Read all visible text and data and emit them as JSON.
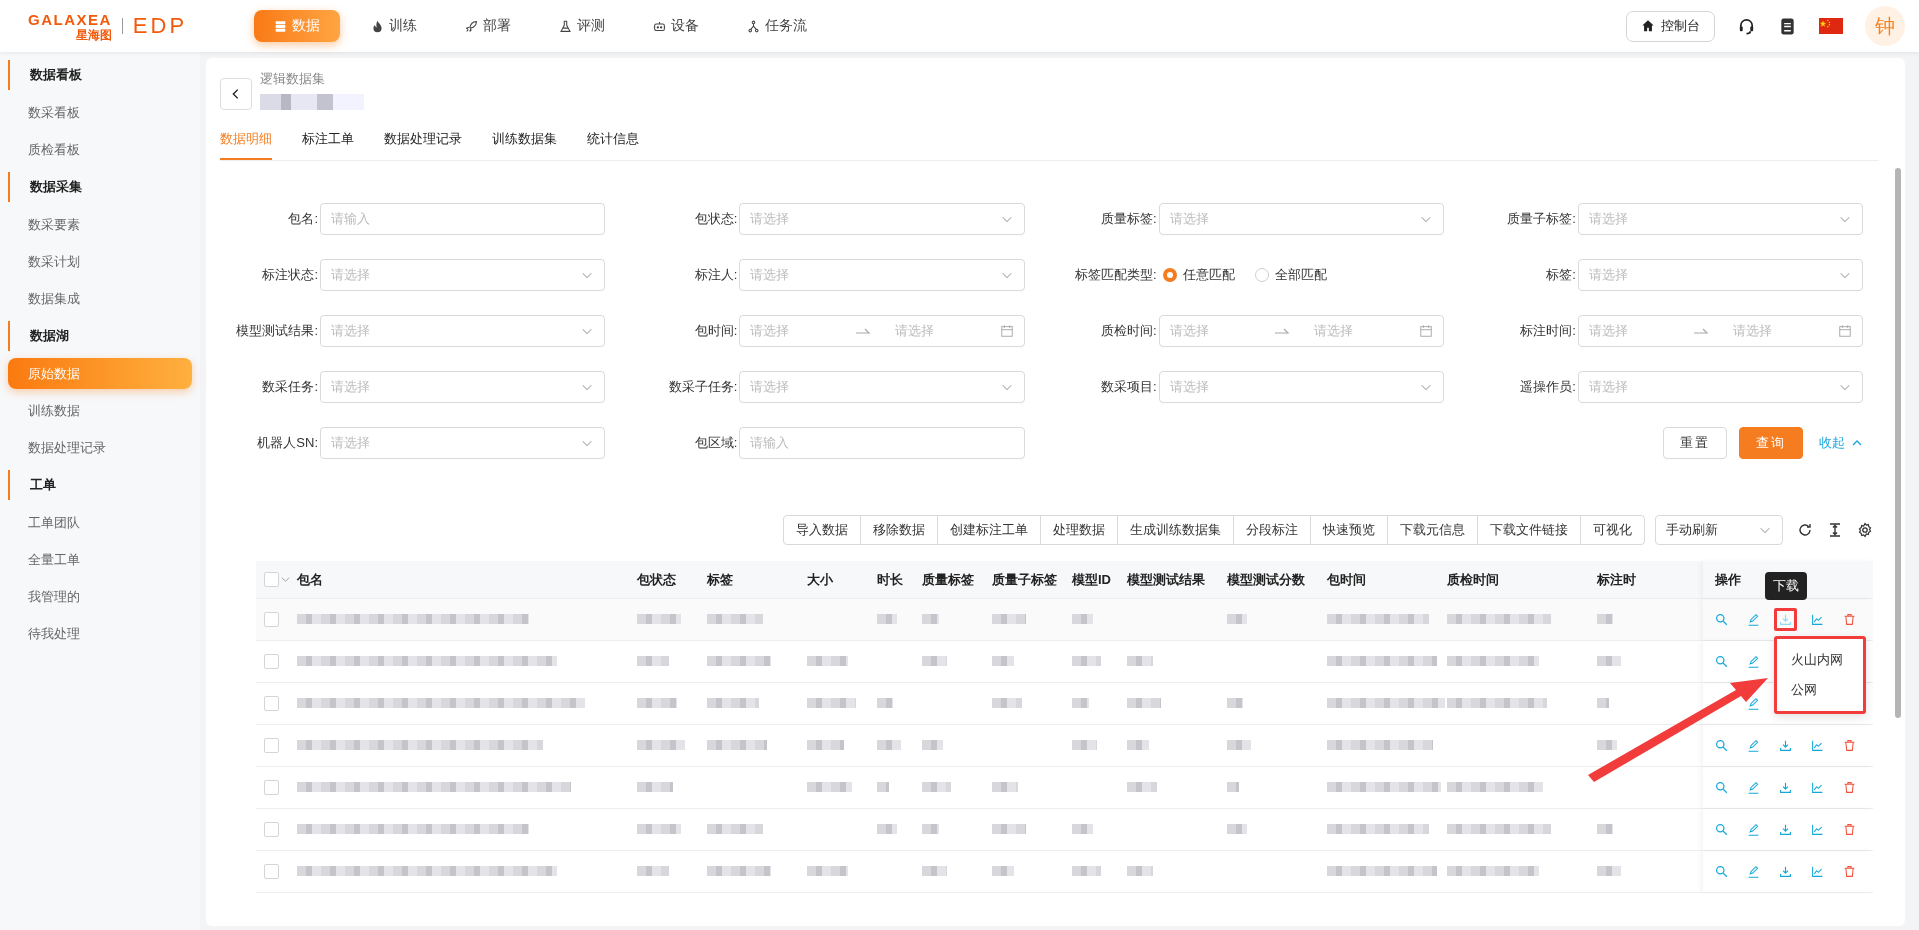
{
  "logo": {
    "wordmark": "GALAXEA",
    "name": "星海图",
    "product": "EDP"
  },
  "nav": [
    {
      "label": "数据",
      "kind": "data",
      "selected": true
    },
    {
      "label": "训练",
      "kind": "fire",
      "selected": false
    },
    {
      "label": "部署",
      "kind": "rocket",
      "selected": false
    },
    {
      "label": "评测",
      "kind": "flask",
      "selected": false
    },
    {
      "label": "设备",
      "kind": "robot",
      "selected": false
    },
    {
      "label": "任务流",
      "kind": "flow",
      "selected": false
    }
  ],
  "header_right": {
    "console_button": "控制台",
    "avatar": "钟"
  },
  "sidebar": [
    {
      "heading": "数据看板",
      "items": [
        {
          "label": "数采看板",
          "selected": false
        },
        {
          "label": "质检看板",
          "selected": false
        }
      ]
    },
    {
      "heading": "数据采集",
      "items": [
        {
          "label": "数采要素",
          "selected": false
        },
        {
          "label": "数采计划",
          "selected": false
        },
        {
          "label": "数据集成",
          "selected": false
        }
      ]
    },
    {
      "heading": "数据湖",
      "items": [
        {
          "label": "原始数据",
          "selected": true
        },
        {
          "label": "训练数据",
          "selected": false
        },
        {
          "label": "数据处理记录",
          "selected": false
        }
      ]
    },
    {
      "heading": "工单",
      "items": [
        {
          "label": "工单团队",
          "selected": false
        },
        {
          "label": "全量工单",
          "selected": false
        },
        {
          "label": "我管理的",
          "selected": false
        },
        {
          "label": "待我处理",
          "selected": false
        }
      ]
    }
  ],
  "breadcrumb": "逻辑数据集",
  "tabs": [
    {
      "label": "数据明细",
      "selected": true
    },
    {
      "label": "标注工单",
      "selected": false
    },
    {
      "label": "数据处理记录",
      "selected": false
    },
    {
      "label": "训练数据集",
      "selected": false
    },
    {
      "label": "统计信息",
      "selected": false
    }
  ],
  "filters": [
    {
      "label": "包名:",
      "kind": "input",
      "placeholder": "请输入"
    },
    {
      "label": "包状态:",
      "kind": "select",
      "placeholder": "请选择"
    },
    {
      "label": "质量标签:",
      "kind": "select",
      "placeholder": "请选择"
    },
    {
      "label": "质量子标签:",
      "kind": "select",
      "placeholder": "请选择"
    },
    {
      "label": "标注状态:",
      "kind": "select",
      "placeholder": "请选择"
    },
    {
      "label": "标注人:",
      "kind": "select",
      "placeholder": "请选择"
    },
    {
      "label": "标签匹配类型:",
      "kind": "radio",
      "options": [
        {
          "label": "任意匹配",
          "selected": true
        },
        {
          "label": "全部匹配",
          "selected": false
        }
      ]
    },
    {
      "label": "标签:",
      "kind": "select",
      "placeholder": "请选择"
    },
    {
      "label": "模型测试结果:",
      "kind": "select",
      "placeholder": "请选择"
    },
    {
      "label": "包时间:",
      "kind": "daterange",
      "placeholder": "请选择",
      "placeholder_end": "请选择"
    },
    {
      "label": "质检时间:",
      "kind": "daterange",
      "placeholder": "请选择",
      "placeholder_end": "请选择"
    },
    {
      "label": "标注时间:",
      "kind": "daterange",
      "placeholder": "请选择",
      "placeholder_end": "请选择"
    },
    {
      "label": "数采任务:",
      "kind": "select",
      "placeholder": "请选择"
    },
    {
      "label": "数采子任务:",
      "kind": "select",
      "placeholder": "请选择"
    },
    {
      "label": "数采项目:",
      "kind": "select",
      "placeholder": "请选择"
    },
    {
      "label": "遥操作员:",
      "kind": "select",
      "placeholder": "请选择"
    },
    {
      "label": "机器人SN:",
      "kind": "select",
      "placeholder": "请选择"
    },
    {
      "label": "包区域:",
      "kind": "input",
      "placeholder": "请输入"
    }
  ],
  "filter_actions": {
    "reset": "重置",
    "search": "查询",
    "collapse": "收起"
  },
  "toolbar": {
    "buttons": [
      "导入数据",
      "移除数据",
      "创建标注工单",
      "处理数据",
      "生成训练数据集",
      "分段标注",
      "快速预览",
      "下载元信息",
      "下载文件链接",
      "可视化"
    ],
    "refresh_select": "手动刷新"
  },
  "table": {
    "all_checked": false,
    "columns": [
      "包名",
      "包状态",
      "标签",
      "大小",
      "时长",
      "质量标签",
      "质量子标签",
      "模型ID",
      "模型测试结果",
      "模型测试分数",
      "包时间",
      "质检时间",
      "标注时"
    ],
    "action_column": "操作",
    "rows": [
      {
        "checked": false
      },
      {
        "checked": false
      },
      {
        "checked": false
      },
      {
        "checked": false
      },
      {
        "checked": false
      },
      {
        "checked": false
      },
      {
        "checked": false
      }
    ],
    "download_tooltip": "下载",
    "download_menu": [
      "火山内网",
      "公网"
    ]
  }
}
